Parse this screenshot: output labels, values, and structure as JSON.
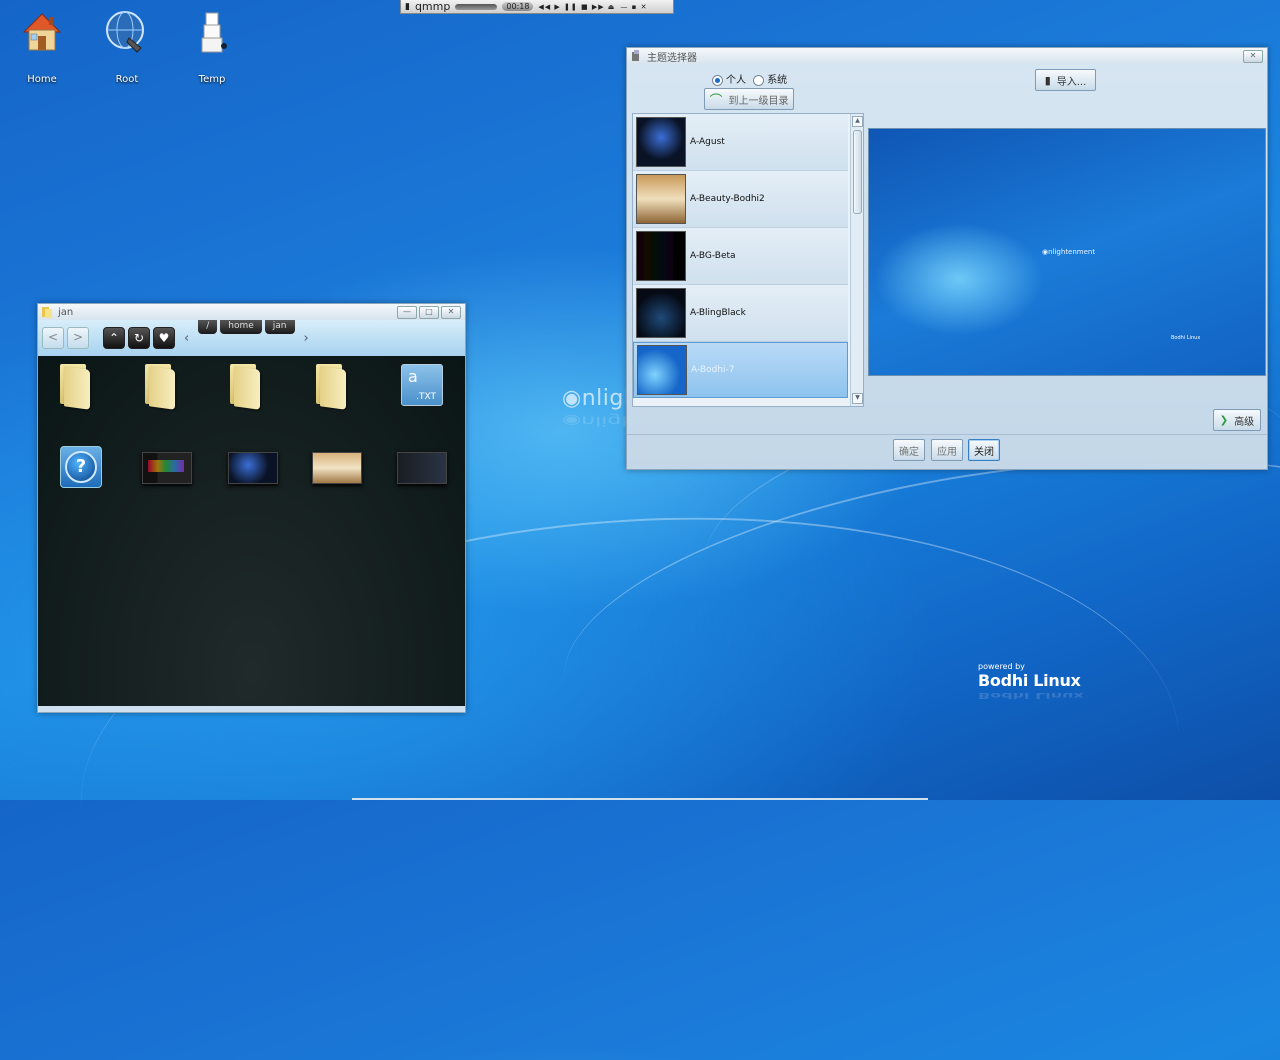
{
  "desktop": {
    "icons": [
      {
        "label": "Home",
        "icon": "home-icon"
      },
      {
        "label": "Root",
        "icon": "root-globe-icon"
      },
      {
        "label": "Temp",
        "icon": "temp-boxes-icon"
      }
    ],
    "watermark": "nlightenment",
    "powered_by": "powered by",
    "brand": "Bodhi Linux"
  },
  "player": {
    "title": "qmmp",
    "time": "00:18",
    "controls_icon": "playback-controls-icon"
  },
  "file_manager": {
    "title": "jan",
    "breadcrumbs": [
      "/",
      "home",
      "jan"
    ],
    "text_file_letter": "a",
    "text_file_ext": ".TXT",
    "help_glyph": "?"
  },
  "theme_selector": {
    "title": "主题选择器",
    "radio_personal": "个人",
    "radio_system": "系统",
    "selected_radio": "个人",
    "up_dir_button": "到上一级目录",
    "import_button": "导入...",
    "themes": [
      {
        "name": "A-Agust"
      },
      {
        "name": "A-Beauty-Bodhi2"
      },
      {
        "name": "A-BG-Beta"
      },
      {
        "name": "A-BlingBlack"
      },
      {
        "name": "A-Bodhi-7"
      }
    ],
    "selected_theme": "A-Bodhi-7",
    "preview_logo": "nlightenment",
    "preview_brand": "Bodhi Linux",
    "advanced_button": "高级",
    "ok_button": "确定",
    "apply_button": "应用",
    "close_button": "关闭"
  },
  "colors": {
    "desktop_blue": "#1a86e0",
    "window_frame": "#cfe0ee",
    "selection": "#8ec3ee"
  }
}
